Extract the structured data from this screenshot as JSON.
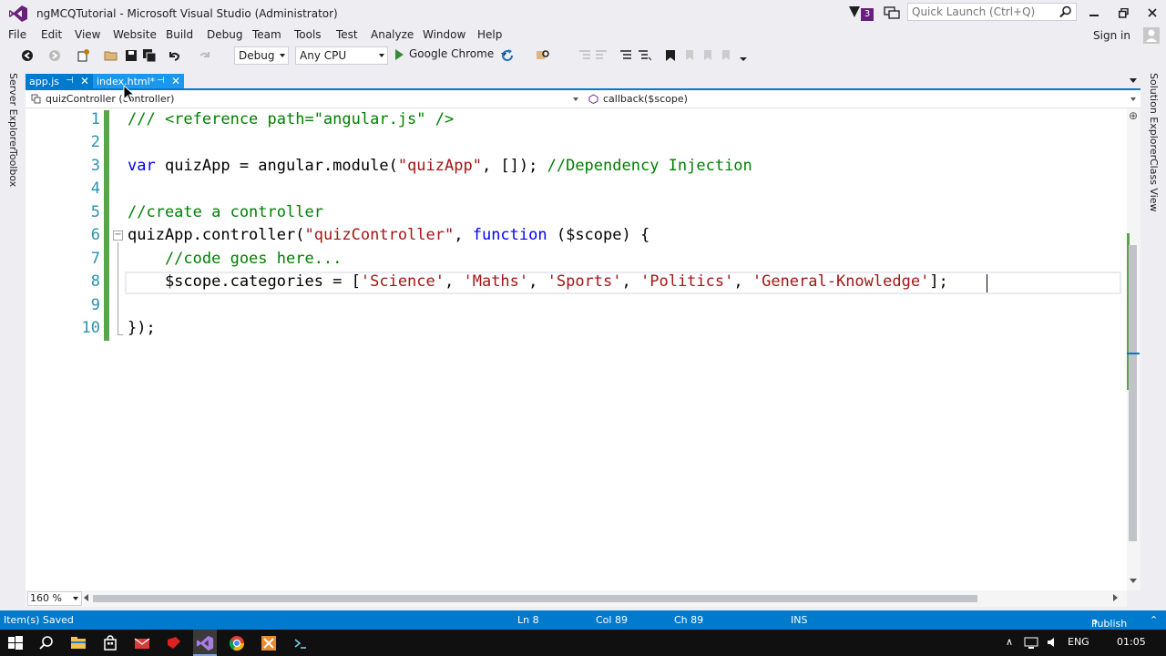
{
  "window": {
    "title": "ngMCQTutorial - Microsoft Visual Studio (Administrator)",
    "notification_count": "3",
    "quick_launch_placeholder": "Quick Launch (Ctrl+Q)"
  },
  "menu": {
    "items": [
      "File",
      "Edit",
      "View",
      "Website",
      "Build",
      "Debug",
      "Team",
      "Tools",
      "Test",
      "Analyze",
      "Window",
      "Help"
    ],
    "sign_in": "Sign in"
  },
  "toolbar": {
    "configuration": "Debug",
    "platform": "Any CPU",
    "start_target": "Google Chrome"
  },
  "side_left": [
    "Server Explorer",
    "Toolbox"
  ],
  "side_right": [
    "Solution Explorer",
    "Class View"
  ],
  "tabs": [
    {
      "label": "app.js",
      "active": true
    },
    {
      "label": "index.html*",
      "active": false
    }
  ],
  "navbar": {
    "scope": "quizController (controller)",
    "member": "callback($scope)"
  },
  "editor": {
    "line_numbers": [
      "1",
      "2",
      "3",
      "4",
      "5",
      "6",
      "7",
      "8",
      "9",
      "10"
    ],
    "lines": {
      "l1": "/// <reference path=\"angular.js\" />",
      "l3_kw": "var",
      "l3_a": " quizApp = angular.module(",
      "l3_s": "\"quizApp\"",
      "l3_b": ", []); ",
      "l3_c": "//Dependency Injection",
      "l5": "//create a controller",
      "l6_a": "quizApp.controller(",
      "l6_s": "\"quizController\"",
      "l6_b": ", ",
      "l6_kw": "function",
      "l6_c": " ($scope) {",
      "l7": "    //code goes here...",
      "l8_a": "    $scope.categories = [",
      "l8_s1": "'Science'",
      "l8_s2": "'Maths'",
      "l8_s3": "'Sports'",
      "l8_s4": "'Politics'",
      "l8_s5": "'General-Knowledge'",
      "sep": ", ",
      "l8_end": "];",
      "l10": "});"
    },
    "current_line": "8",
    "zoom": "160 %"
  },
  "status": {
    "message": "Item(s) Saved",
    "ln": "Ln 8",
    "col": "Col 89",
    "ch": "Ch 89",
    "mode": "INS",
    "publish": "Publish"
  },
  "taskbar": {
    "language": "ENG",
    "time": "01:05"
  },
  "colors": {
    "accent": "#007acc",
    "keyword": "#0000ff",
    "string": "#a31515",
    "comment": "#008000",
    "line_number": "#2b91af",
    "changed_lines": "#57a64a"
  }
}
